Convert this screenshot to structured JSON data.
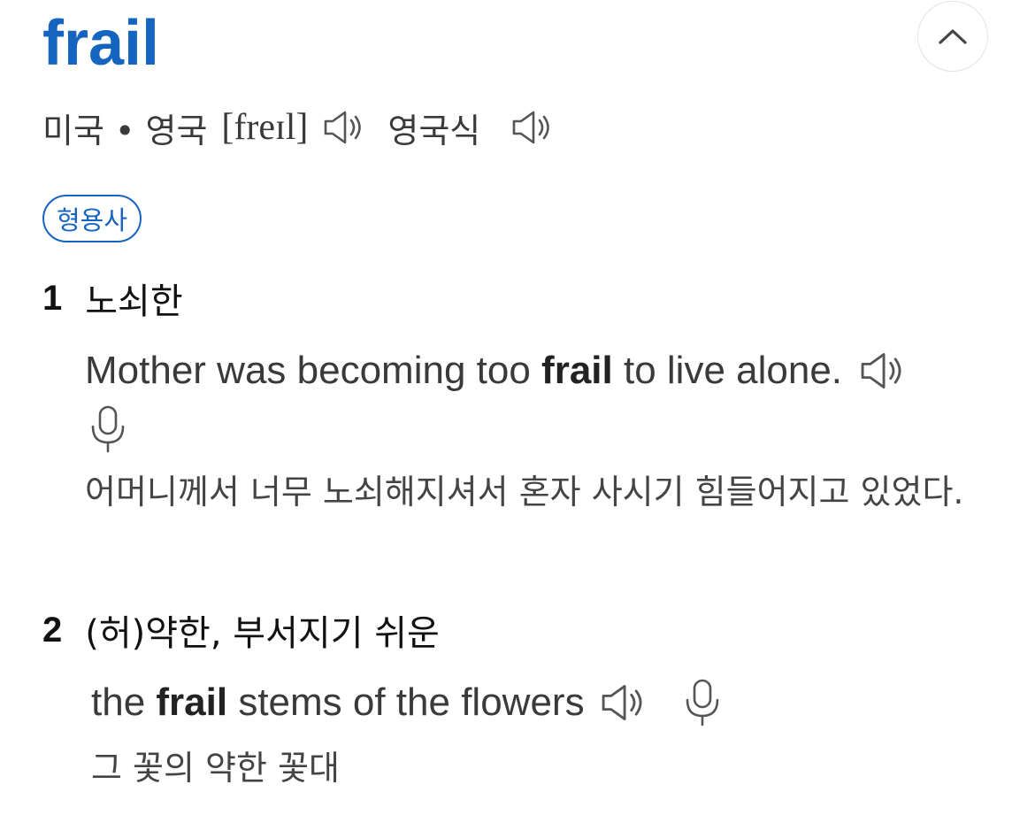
{
  "entry": {
    "headword": "frail"
  },
  "pronunciation": {
    "region_label": "미국 • 영국",
    "ipa": "[freɪl]",
    "region_label_2": "영국식"
  },
  "part_of_speech": "형용사",
  "senses": [
    {
      "number": "1",
      "definition": "노쇠한",
      "example": {
        "before": "Mother was becoming too ",
        "highlight": "frail",
        "after": " to live alone."
      },
      "translation": "어머니께서 너무 노쇠해지셔서 혼자 사시기 힘들어지고 있었다."
    },
    {
      "number": "2",
      "definition": "(허)약한, 부서지기 쉬운",
      "example": {
        "before": "the ",
        "highlight": "frail",
        "after": " stems of the flowers"
      },
      "translation": "그 꽃의 약한 꽃대"
    }
  ],
  "icons": {
    "collapse": "chevron-up-icon",
    "audio": "speaker-icon",
    "record": "microphone-icon"
  },
  "colors": {
    "accent": "#1565c0",
    "icon": "#6b6b6b"
  }
}
